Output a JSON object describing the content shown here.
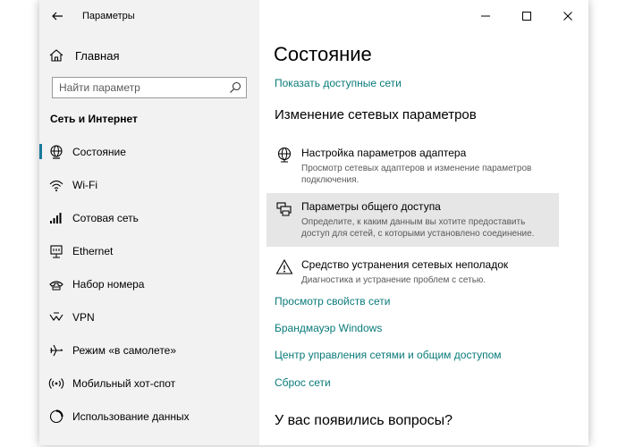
{
  "window": {
    "title": "Параметры",
    "controls": {
      "minimize": "–",
      "maximize": "☐",
      "close": "✕"
    }
  },
  "sidebar": {
    "home_label": "Главная",
    "search": {
      "placeholder": "Найти параметр",
      "value": ""
    },
    "section_heading": "Сеть и Интернет",
    "items": [
      {
        "label": "Состояние",
        "icon": "globe-status-icon",
        "active": true
      },
      {
        "label": "Wi-Fi",
        "icon": "wifi-icon"
      },
      {
        "label": "Сотовая сеть",
        "icon": "cellular-icon"
      },
      {
        "label": "Ethernet",
        "icon": "ethernet-icon"
      },
      {
        "label": "Набор номера",
        "icon": "dialup-icon"
      },
      {
        "label": "VPN",
        "icon": "vpn-icon"
      },
      {
        "label": "Режим «в самолете»",
        "icon": "airplane-icon"
      },
      {
        "label": "Мобильный хот-спот",
        "icon": "hotspot-icon"
      },
      {
        "label": "Использование данных",
        "icon": "data-usage-icon"
      }
    ]
  },
  "main": {
    "title": "Состояние",
    "show_networks_link": "Показать доступные сети",
    "change_heading": "Изменение сетевых параметров",
    "settings": [
      {
        "title": "Настройка параметров адаптера",
        "desc": "Просмотр сетевых адаптеров и изменение параметров подключения.",
        "icon": "adapter-globe-icon"
      },
      {
        "title": "Параметры общего доступа",
        "desc": "Определите, к каким данным вы хотите предоставить доступ для сетей, с которыми установлено соединение.",
        "icon": "sharing-printer-icon"
      },
      {
        "title": "Средство устранения сетевых неполадок",
        "desc": "Диагностика и устранение проблем с сетью.",
        "icon": "warning-icon"
      }
    ],
    "links": [
      "Просмотр свойств сети",
      "Брандмауэр Windows",
      "Центр управления сетями и общим доступом",
      "Сброс сети"
    ],
    "questions_heading": "У вас появились вопросы?"
  },
  "colors": {
    "accent": "#0a7a7a",
    "active_indicator": "#1a7a9c",
    "sidebar_bg": "#f2f2f2",
    "highlight_bg": "#e6e6e6"
  }
}
